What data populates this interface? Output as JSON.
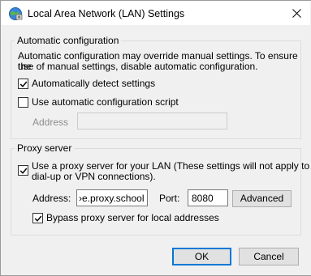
{
  "window": {
    "title": "Local Area Network (LAN) Settings",
    "icon": "network-settings-icon",
    "close_icon": "close-icon"
  },
  "automatic_configuration": {
    "legend": "Automatic configuration",
    "description_line1": "Automatic configuration may override manual settings.  To ensure the",
    "description_line2": "use of manual settings, disable automatic configuration.",
    "auto_detect_label": "Automatically detect settings",
    "auto_detect_checked": true,
    "use_script_label": "Use automatic configuration script",
    "use_script_checked": false,
    "address_label": "Address",
    "address_value": ""
  },
  "proxy_server": {
    "legend": "Proxy server",
    "use_proxy_line1": "Use a proxy server for your LAN (These settings will not apply to",
    "use_proxy_line2": "dial-up or VPN connections).",
    "use_proxy_checked": true,
    "address_label": "Address:",
    "address_value": "›e.proxy.school",
    "port_label": "Port:",
    "port_value": "8080",
    "advanced_label": "Advanced",
    "bypass_label": "Bypass proxy server for local addresses",
    "bypass_checked": true
  },
  "buttons": {
    "ok_label": "OK",
    "cancel_label": "Cancel"
  },
  "colors": {
    "accent": "#0078d7",
    "background": "#f0f0f0"
  }
}
